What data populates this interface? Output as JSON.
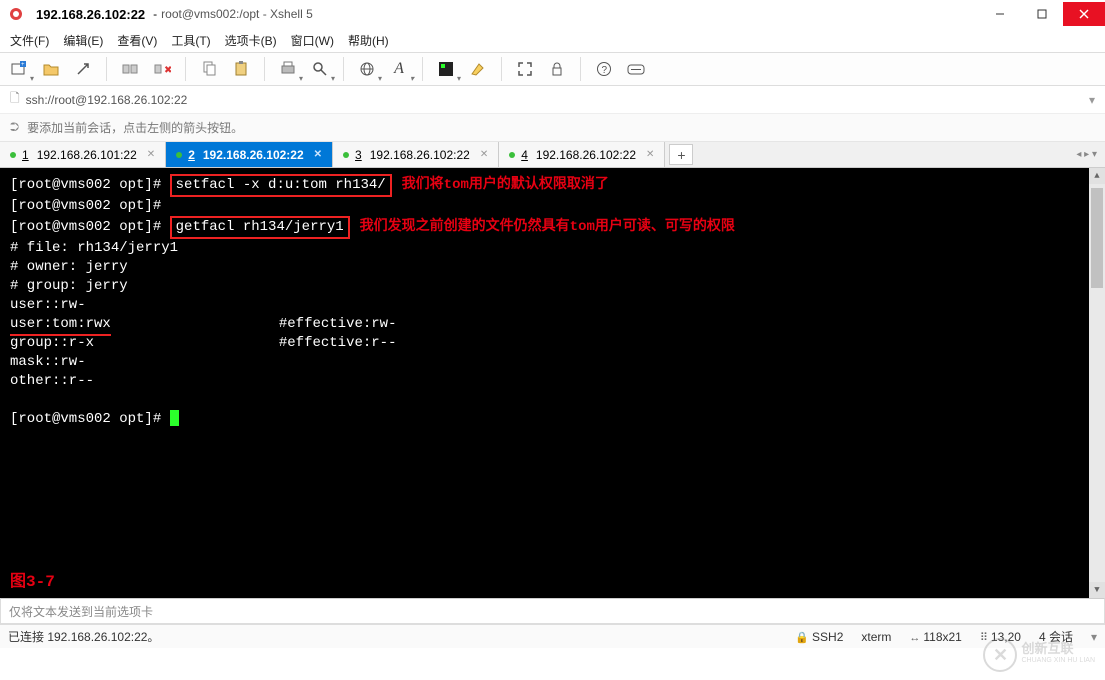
{
  "title": {
    "ip": "192.168.26.102:22",
    "suffix": "root@vms002:/opt - Xshell 5"
  },
  "menu": {
    "file": "文件(F)",
    "edit": "编辑(E)",
    "view": "查看(V)",
    "tools": "工具(T)",
    "tab": "选项卡(B)",
    "window": "窗口(W)",
    "help": "帮助(H)"
  },
  "addressbar": {
    "url": "ssh://root@192.168.26.102:22"
  },
  "tipbar": {
    "text": "要添加当前会话，点击左侧的箭头按钮。"
  },
  "tabs": [
    {
      "num": "1",
      "label": "192.168.26.101:22",
      "active": false
    },
    {
      "num": "2",
      "label": "192.168.26.102:22",
      "active": true
    },
    {
      "num": "3",
      "label": "192.168.26.102:22",
      "active": false
    },
    {
      "num": "4",
      "label": "192.168.26.102:22",
      "active": false
    }
  ],
  "terminal": {
    "prompt": "[root@vms002 opt]#",
    "cmd1": "setfacl -x d:u:tom rh134/",
    "note1": "我们将tom用户的默认权限取消了",
    "cmd2": "getfacl rh134/jerry1",
    "note2": "我们发现之前创建的文件仍然具有tom用户可读、可写的权限",
    "l_file": "# file: rh134/jerry1",
    "l_owner": "# owner: jerry",
    "l_group": "# group: jerry",
    "l_userrw": "user::rw-",
    "l_usertom": "user:tom:rwx",
    "l_eff1": "#effective:rw-",
    "l_grp": "group::r-x",
    "l_eff2": "#effective:r--",
    "l_mask": "mask::rw-",
    "l_other": "other::r--",
    "fig": "图3-7"
  },
  "sendbar": {
    "placeholder": "仅将文本发送到当前选项卡"
  },
  "status": {
    "conn": "已连接 192.168.26.102:22。",
    "ssh": "SSH2",
    "term": "xterm",
    "size": "118x21",
    "pos": "13,20",
    "sessions": "4 会话"
  },
  "watermark": {
    "brand_cn": "创新互联",
    "brand_py": "CHUANG XIN HU LIAN"
  }
}
